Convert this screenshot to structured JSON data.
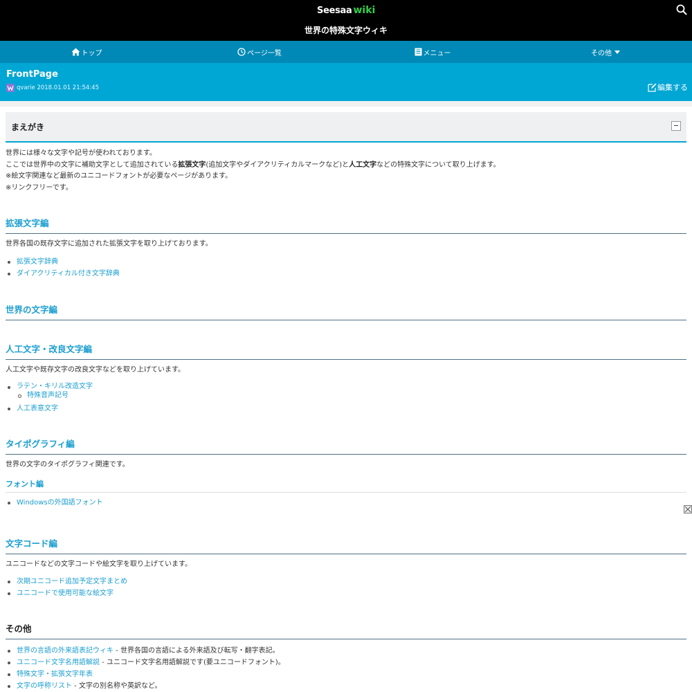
{
  "header": {
    "logo_main": "Seesaa",
    "logo_wiki": "wiki",
    "site_title": "世界の特殊文字ウィキ",
    "search_icon": "search-icon"
  },
  "nav": {
    "top": "トップ",
    "page_list": "ページ一覧",
    "menu": "メニュー",
    "other": "その他"
  },
  "page": {
    "title": "FrontPage",
    "author": "qvarie",
    "timestamp": "2018.01.01 21:54:45",
    "edit_label": "編集する"
  },
  "preface": {
    "heading": "まえがき",
    "line1": "世界には様々な文字や記号が使われております。",
    "line2_a": "ここでは世界中の文字に補助文字として追加されている",
    "line2_b": "拡張文字",
    "line2_c": "(追加文字やダイアクリティカルマークなど)と",
    "line2_d": "人工文字",
    "line2_e": "などの特殊文字について取り上げます。",
    "line3": "※絵文字関連など最新のユニコードフォントが必要なページがあります。",
    "line4": "※リンクフリーです。"
  },
  "sections": {
    "extended": {
      "heading": "拡張文字編",
      "desc": "世界各国の既存文字に追加された拡張文字を取り上げております。",
      "links": [
        "拡張文字辞典",
        "ダイアクリティカル付き文字辞典"
      ]
    },
    "world": {
      "heading": "世界の文字編"
    },
    "artificial": {
      "heading": "人工文字・改良文字編",
      "desc": "人工文字や既存文字の改良文字などを取り上げています。",
      "link1": "ラテン・キリル改造文字",
      "sublink": "特殊音声記号",
      "link2": "人工表意文字"
    },
    "typography": {
      "heading": "タイポグラフィ編",
      "desc": "世界の文字のタイポグラフィ関連です。",
      "font_heading": "フォント編",
      "link": "Windowsの外国語フォント"
    },
    "charcode": {
      "heading": "文字コード編",
      "desc": "ユニコードなどの文字コードや絵文字を取り上げています。",
      "links": [
        "次期ユニコード追加予定文字まとめ",
        "ユニコードで使用可能な絵文字"
      ]
    },
    "other": {
      "heading": "その他",
      "items": [
        {
          "link": "世界の言語の外来語表記ウィキ",
          "desc": " - 世界各国の言語による外来語及び転写・翻字表記。"
        },
        {
          "link": "ユニコード文字名用語解説",
          "desc": " - ユニコード文字名用語解説です(要ユニコードフォント)。"
        },
        {
          "link": "特殊文字・拡張文字年表",
          "desc": ""
        },
        {
          "link": "文字の呼称リスト",
          "desc": " - 文字の別名称や英訳など。"
        }
      ]
    }
  },
  "colors": {
    "topbar": "#000000",
    "navbar": "#0089b6",
    "pagehead": "#00a6d4",
    "link": "#1a9ed0",
    "logo_wiki": "#2fd04a"
  }
}
